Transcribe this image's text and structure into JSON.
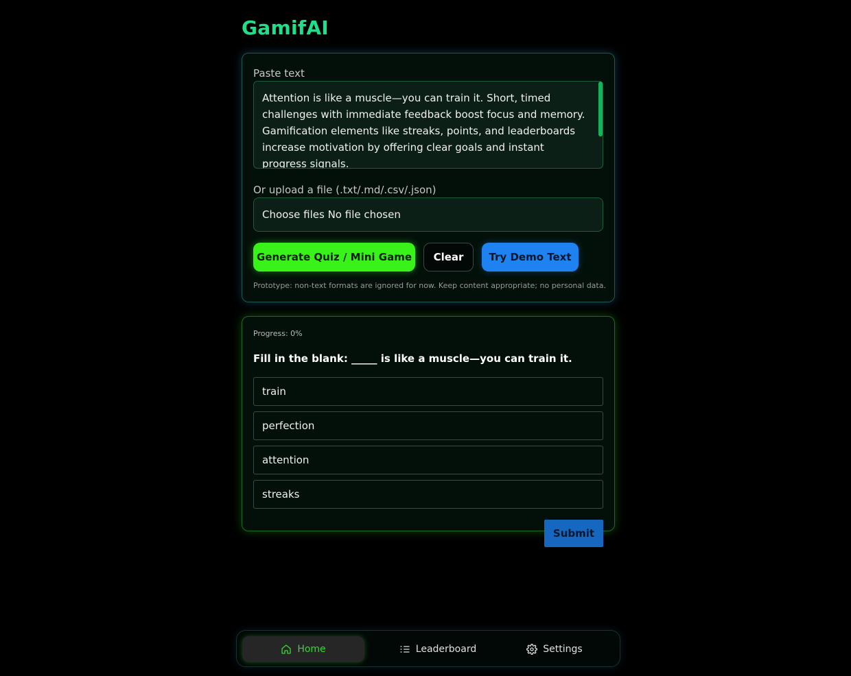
{
  "app": {
    "title": "GamifAI"
  },
  "input_card": {
    "paste_label": "Paste text",
    "textarea_value": "Attention is like a muscle—you can train it. Short, timed challenges with immediate feedback boost focus and memory.\nGamification elements like streaks, points, and leaderboards increase motivation by offering clear goals and instant progress signals.",
    "upload_label": "Or upload a file (.txt/.md/.csv/.json)",
    "file_input_text": "Choose files No file chosen",
    "buttons": {
      "generate": "Generate Quiz / Mini Game",
      "clear": "Clear",
      "demo": "Try Demo Text"
    },
    "disclaimer": "Prototype: non-text formats are ignored for now. Keep content appropriate; no personal data."
  },
  "quiz": {
    "progress_label": "Progress: 0%",
    "progress_value": 0,
    "question": "Fill in the blank: _____ is like a muscle—you can train it.",
    "options": [
      "train",
      "perfection",
      "attention",
      "streaks"
    ],
    "submit_label": "Submit"
  },
  "nav": {
    "items": [
      {
        "label": "Home",
        "icon": "home-icon",
        "active": true
      },
      {
        "label": "Leaderboard",
        "icon": "list-icon",
        "active": false
      },
      {
        "label": "Settings",
        "icon": "gear-icon",
        "active": false
      }
    ]
  },
  "colors": {
    "accent_green": "#39f21a",
    "title_green": "#1fe08a",
    "accent_blue": "#1e82f0",
    "submit_blue": "#1667c0",
    "background": "#000000"
  }
}
